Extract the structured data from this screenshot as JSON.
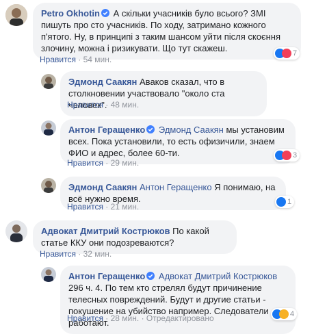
{
  "comments": [
    {
      "author": "Petro Okhotin",
      "verified": true,
      "mention": "",
      "text": "А скільки учасників було всього? ЗМІ пишуть про сто учасників. По ходу, затримано кожного п'ятого. Ну, в принципі з таким шансом уйти після скоєння злочину, можна і ризикувати. Що тут скажеш.",
      "like_label": "Нравится",
      "time": "54 мин.",
      "reaction_count": "7",
      "reactions": [
        "like",
        "love"
      ]
    },
    {
      "author": "Эдмонд Саакян",
      "verified": false,
      "mention": "",
      "text": "Аваков сказал, что в столкновении участвовало \"около ста человек\".",
      "like_label": "Нравится",
      "time": "48 мин.",
      "reaction_count": "",
      "reactions": []
    },
    {
      "author": "Антон Геращенко",
      "verified": true,
      "mention": "Эдмонд Саакян",
      "text": "мы установим всех. Пока установили, то есть офизичили, знаем ФИО и адрес, более 60-ти.",
      "like_label": "Нравится",
      "time": "29 мин.",
      "reaction_count": "3",
      "reactions": [
        "like",
        "love"
      ]
    },
    {
      "author": "Эдмонд Саакян",
      "verified": false,
      "mention": "Антон Геращенко",
      "text": "Я понимаю, на всё нужно время.",
      "like_label": "Нравится",
      "time": "21 мин.",
      "reaction_count": "1",
      "reactions": [
        "like"
      ]
    },
    {
      "author": "Адвокат Дмитрий Кострюков",
      "verified": false,
      "mention": "",
      "text": "По какой статье ККУ они подозреваются?",
      "like_label": "Нравится",
      "time": "32 мин.",
      "reaction_count": "",
      "reactions": []
    },
    {
      "author": "Антон Геращенко",
      "verified": true,
      "mention": "Адвокат Дмитрий Кострюков",
      "text": "296 ч. 4. По тем кто стрелял будут причинение телесных повреждений. Будут и другие статьи - покушение на убийство например. Следователи работают.",
      "like_label": "Нравится",
      "time": "28 мин.",
      "edited": "Отредактировано",
      "reaction_count": "4",
      "reactions": [
        "like",
        "haha"
      ]
    }
  ],
  "colors": {
    "link": "#385898",
    "bubble": "#f2f3f5",
    "meta": "#90949c",
    "like_react": "#1877f2",
    "love_react": "#f33e58",
    "haha_react": "#f7b125"
  }
}
